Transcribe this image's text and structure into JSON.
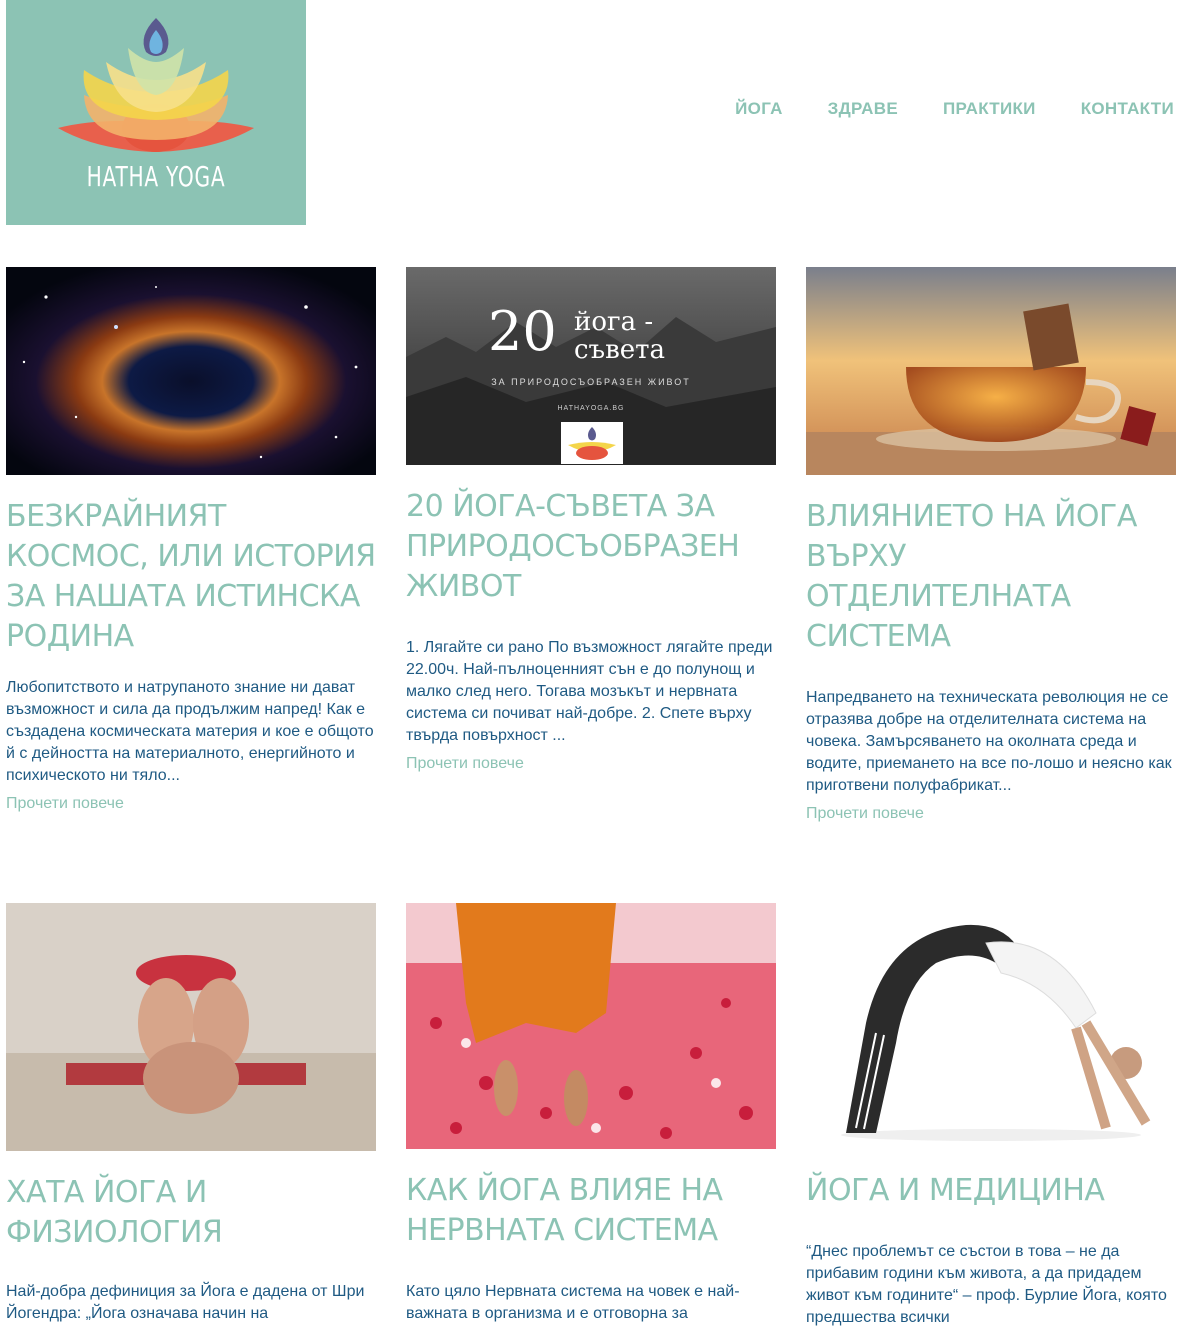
{
  "logo": {
    "text": "HATHA YOGA"
  },
  "nav": [
    "ЙОГА",
    "ЗДРАВЕ",
    "ПРАКТИКИ",
    "КОНТАКТИ"
  ],
  "colors": {
    "accent": "#8cc3b4",
    "body_text": "#1f5a83"
  },
  "thumb2": {
    "number": "20",
    "line1": "йога -",
    "line2": "съвета",
    "tagline": "ЗА ПРИРОДОСЪОБРАЗЕН ЖИВОТ",
    "site": "HATHAYOGA.BG"
  },
  "posts": [
    {
      "image": "cosmic-nebula-image",
      "title": "БЕЗКРАЙНИЯТ КОСМОС, ИЛИ ИСТОРИЯ ЗА НАШАТА ИСТИНСКА РОДИНА",
      "excerpt": "Любопитството и натрупаното знание ни дават възможност и сила да продължим напред! Как е създадена космическата материя и кое е общото й с дейността на материалното, енергийното и психическото ни тяло...",
      "more": "Прочети повече"
    },
    {
      "image": "mountains-20-tips-image",
      "title": "20 ЙОГА-СЪВЕТА ЗА ПРИРОДОСЪОБРАЗЕН ЖИВОТ",
      "excerpt": "1. Лягайте си рано По възможност лягайте преди 22.00ч. Най-пълноценният сън е до полунощ и малко след него. Тогава мозъкът и нервната система си почиват най-добре. 2. Спете върху твърда повърхност ...",
      "more": "Прочети повече"
    },
    {
      "image": "tea-cup-image",
      "title": "ВЛИЯНИЕТО НА ЙОГА ВЪРХУ ОТДЕЛИТЕЛНАТА СИСТЕМА",
      "excerpt": "Напредването на техническата революция не се отразява добре на отделителната система на човека. Замърсяването на околната среда и водите, приемането на все по-лошо и неясно как приготвени полуфабрикат...",
      "more": "Прочети повече"
    },
    {
      "image": "forward-bend-pose-image",
      "title": "ХАТА ЙОГА И ФИЗИОЛОГИЯ",
      "excerpt": "Най-добра дефиниция за Йога е дадена от Шри Йогендра: „Йога означава начин на",
      "more": ""
    },
    {
      "image": "walking-on-petals-image",
      "title": "КАК ЙОГА ВЛИЯЕ НА НЕРВНАТА СИСТЕМА",
      "excerpt": "Като цяло Нервната система на човек е най-важната в организма и е отговорна за",
      "more": ""
    },
    {
      "image": "backbend-pose-image",
      "title": "ЙОГА И МЕДИЦИНА",
      "excerpt": "“Днес проблемът се състои в това – не да прибавим години към живота, а да придадем живот към годините“ – проф. Бурлие Йога, която предшества всички",
      "more": ""
    }
  ]
}
